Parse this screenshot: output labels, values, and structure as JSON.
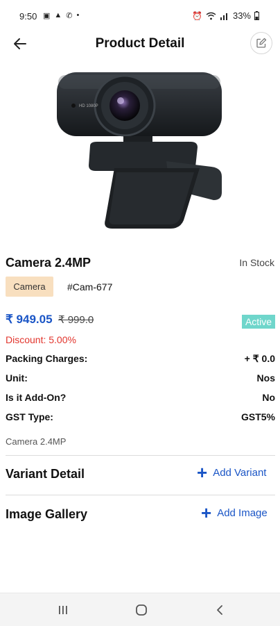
{
  "status_bar": {
    "time": "9:50",
    "battery": "33%",
    "left_icons": [
      "gallery-icon",
      "warning-icon",
      "call-icon",
      "dot-icon"
    ],
    "right_icons": [
      "alarm-icon",
      "wifi-icon",
      "signal-icon",
      "battery-icon"
    ]
  },
  "app_bar": {
    "title": "Product Detail",
    "back_icon": "arrow-left-icon",
    "edit_icon": "edit-icon"
  },
  "product": {
    "name": "Camera 2.4MP",
    "stock_status": "In Stock",
    "category": "Camera",
    "code": "#Cam-677",
    "price": "₹ 949.05",
    "mrp": "₹ 999.0",
    "status": "Active",
    "discount": "Discount: 5.00%",
    "description": "Camera 2.4MP",
    "image_alt": "HD webcam"
  },
  "details": {
    "packing_label": "Packing Charges:",
    "packing_value": "+ ₹ 0.0",
    "unit_label": "Unit:",
    "unit_value": "Nos",
    "addon_label": "Is it Add-On?",
    "addon_value": "No",
    "gst_label": "GST Type:",
    "gst_value": "GST5%"
  },
  "sections": {
    "variant_title": "Variant Detail",
    "variant_action": "Add Variant",
    "gallery_title": "Image Gallery",
    "gallery_action": "Add Image"
  },
  "colors": {
    "accent": "#1a55c6",
    "discount": "#e2352d",
    "active_badge": "#6fd6cb",
    "category_tag": "#f8dfbf"
  },
  "nav_bar": {
    "icons": [
      "recents-icon",
      "home-icon",
      "back-icon"
    ]
  }
}
